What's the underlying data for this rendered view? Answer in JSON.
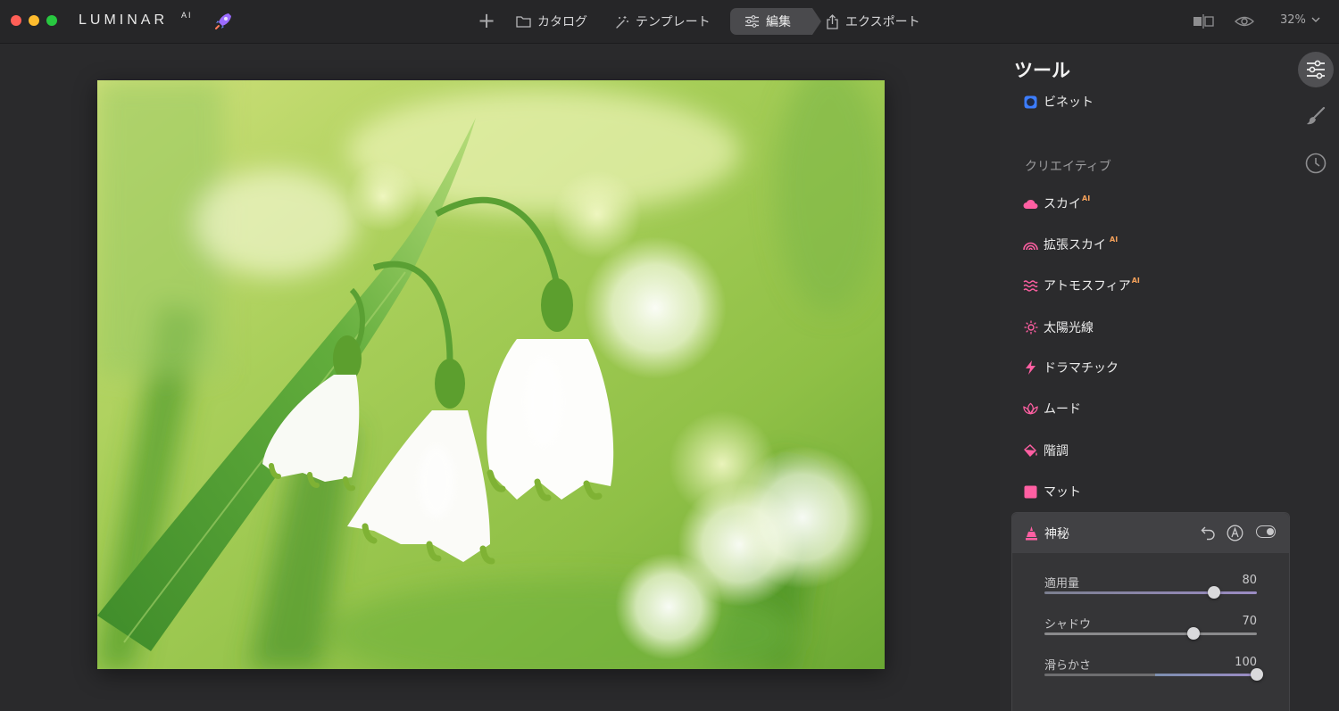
{
  "app": {
    "logo_text": "LUMINAR",
    "logo_suffix": "AI"
  },
  "nav": {
    "add_label": "+",
    "catalog_label": "カタログ",
    "template_label": "テンプレート",
    "edit_label": "編集",
    "export_label": "エクスポート",
    "zoom_label": "32%"
  },
  "panel": {
    "title": "ツール",
    "vignette_label": "ビネット",
    "creative_section_label": "クリエイティブ",
    "tools": [
      {
        "label": "スカイ",
        "ai_badge": "AI",
        "icon": "cloud-icon",
        "color": "#ff5fa2"
      },
      {
        "label": "拡張スカイ",
        "ai_badge": "AI",
        "icon": "rainbow-icon",
        "color": "#ff5fa2"
      },
      {
        "label": "アトモスフィア",
        "ai_badge": "AI",
        "icon": "waves-icon",
        "color": "#ff5fa2"
      },
      {
        "label": "太陽光線",
        "ai_badge": "",
        "icon": "sun-icon",
        "color": "#ff5fa2"
      },
      {
        "label": "ドラマチック",
        "ai_badge": "",
        "icon": "lightning-icon",
        "color": "#ff5fa2"
      },
      {
        "label": "ムード",
        "ai_badge": "",
        "icon": "lotus-icon",
        "color": "#ff5fa2"
      },
      {
        "label": "階調",
        "ai_badge": "",
        "icon": "paint-bucket-icon",
        "color": "#ff5fa2"
      },
      {
        "label": "マット",
        "ai_badge": "",
        "icon": "square-icon",
        "color": "#ff5fa2"
      }
    ],
    "expanded_tool": {
      "label": "神秘",
      "icon": "mystical-icon",
      "sliders": [
        {
          "label": "適用量",
          "value": "80",
          "fraction": 0.8
        },
        {
          "label": "シャドウ",
          "value": "70",
          "fraction": 0.7
        },
        {
          "label": "滑らかさ",
          "value": "100",
          "fraction": 1.0
        }
      ]
    }
  },
  "colors": {
    "accent_pink": "#ff5fa2",
    "accent_blue": "#3c7dff",
    "ai_badge": "#f3a05a"
  }
}
